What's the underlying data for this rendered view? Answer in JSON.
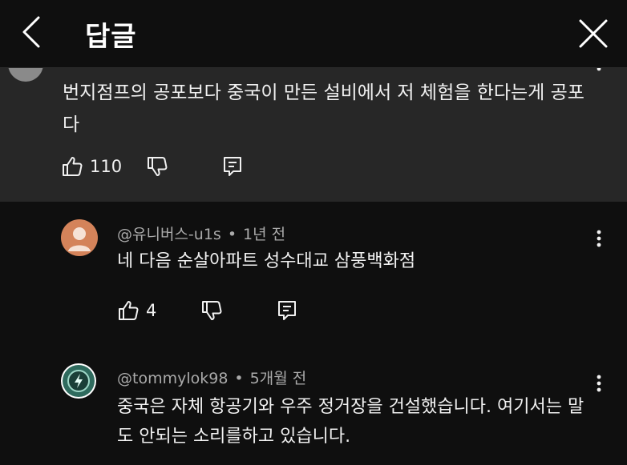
{
  "header": {
    "title": "답글",
    "back_icon": "chevron-left-icon",
    "close_icon": "close-icon"
  },
  "parent_comment": {
    "text": "번지점프의 공포보다 중국이 만든 설비에서 저 체험을 한다는게 공포다",
    "likes": "110"
  },
  "replies": [
    {
      "author": "@유니버스-u1s",
      "time": "1년 전",
      "text": "네 다음 순살아파트 성수대교 삼풍백화점",
      "likes": "4"
    },
    {
      "author": "@tommylok98",
      "time": "5개월 전",
      "text": "중국은 자체 항공기와 우주 정거장을 건설했습니다. 여기서는 말도 안되는 소리를하고 있습니다.",
      "likes": ""
    }
  ],
  "colors": {
    "background": "#0f0f0f",
    "parent_background": "#272727",
    "meta_text": "#aaaaaa",
    "avatar_orange": "#d4835a",
    "avatar_green": "#2f6b5e"
  }
}
